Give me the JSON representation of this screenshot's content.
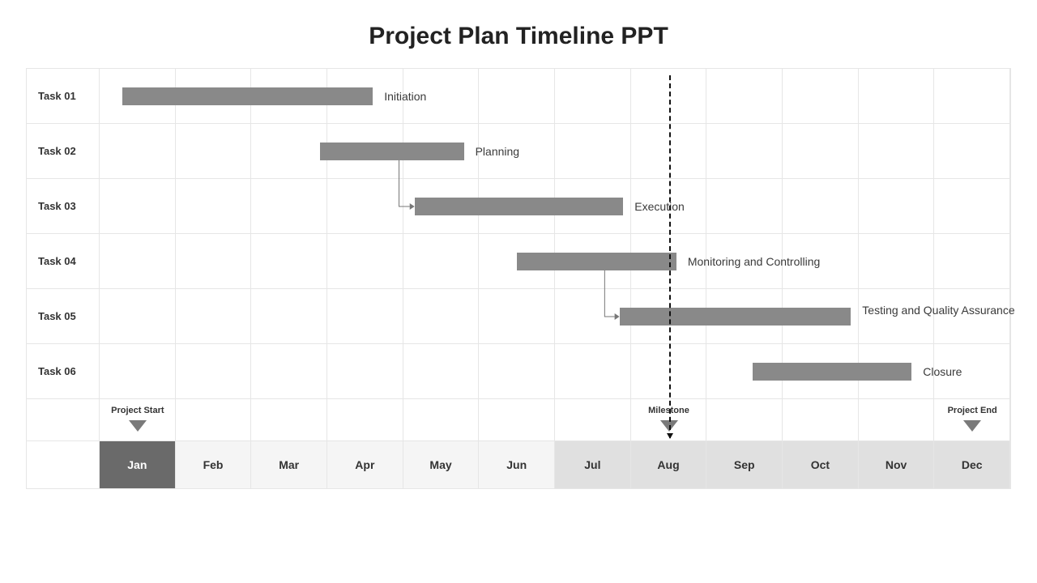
{
  "title": "Project Plan Timeline PPT",
  "chart_data": {
    "type": "bar",
    "categories": [
      "Jan",
      "Feb",
      "Mar",
      "Apr",
      "May",
      "Jun",
      "Jul",
      "Aug",
      "Sep",
      "Oct",
      "Nov",
      "Dec"
    ],
    "xlabel": "",
    "ylabel": "",
    "series": [
      {
        "name": "Task 01",
        "label": "Initiation",
        "start": 0.3,
        "end": 3.6
      },
      {
        "name": "Task 02",
        "label": "Planning",
        "start": 2.9,
        "end": 4.8
      },
      {
        "name": "Task 03",
        "label": "Execution",
        "start": 4.15,
        "end": 6.9
      },
      {
        "name": "Task 04",
        "label": "Monitoring and Controlling",
        "start": 5.5,
        "end": 7.6
      },
      {
        "name": "Task 05",
        "label": "Testing and Quality Assurance",
        "start": 6.85,
        "end": 9.9
      },
      {
        "name": "Task 06",
        "label": "Closure",
        "start": 8.6,
        "end": 10.7
      }
    ],
    "connectors": [
      {
        "from": 1,
        "to": 2
      },
      {
        "from": 3,
        "to": 4
      }
    ],
    "milestones": [
      {
        "label": "Project Start",
        "at": 0.5
      },
      {
        "label": "Milestone",
        "at": 7.5
      },
      {
        "label": "Project End",
        "at": 11.5
      }
    ],
    "milestone_line": {
      "at": 7.5,
      "from_row": 0,
      "to_row": 6
    },
    "title": "Project Plan Timeline PPT"
  },
  "colors": {
    "bar": "#898989",
    "grid": "#e6e6e6"
  }
}
